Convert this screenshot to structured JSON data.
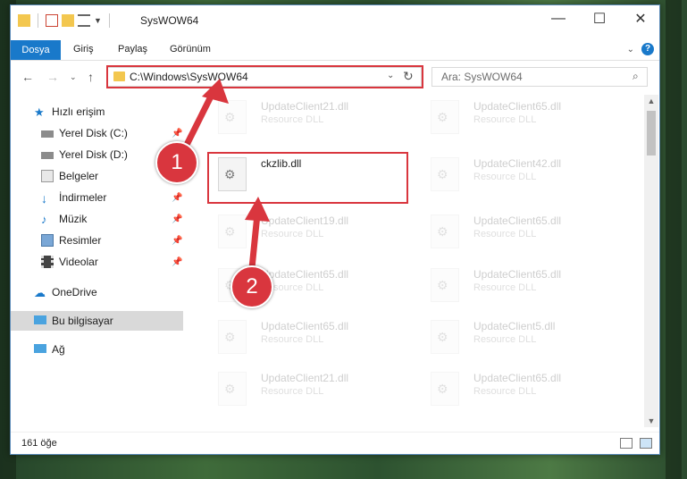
{
  "window": {
    "title": "SysWOW64",
    "controls": [
      "—",
      "☐",
      "✕"
    ]
  },
  "ribbon": {
    "file_tab": "Dosya",
    "tabs": [
      "Giriş",
      "Paylaş",
      "Görünüm"
    ],
    "help": "?"
  },
  "nav": {
    "address": "C:\\Windows\\SysWOW64",
    "search_placeholder": "Ara: SysWOW64"
  },
  "sidebar": {
    "items": [
      {
        "label": "Hızlı erişim",
        "icon": "star-icon",
        "pinned": false
      },
      {
        "label": "Yerel Disk (C:)",
        "icon": "drive-icon",
        "pinned": true
      },
      {
        "label": "Yerel Disk (D:)",
        "icon": "drive-icon",
        "pinned": false
      },
      {
        "label": "Belgeler",
        "icon": "documents-icon",
        "pinned": true
      },
      {
        "label": "İndirmeler",
        "icon": "download-icon",
        "pinned": true
      },
      {
        "label": "Müzik",
        "icon": "music-icon",
        "pinned": true
      },
      {
        "label": "Resimler",
        "icon": "pictures-icon",
        "pinned": true
      },
      {
        "label": "Videolar",
        "icon": "videos-icon",
        "pinned": true
      },
      {
        "label": "OneDrive",
        "icon": "cloud-icon",
        "pinned": false
      },
      {
        "label": "Bu bilgisayar",
        "icon": "computer-icon",
        "pinned": false
      },
      {
        "label": "Ağ",
        "icon": "network-icon",
        "pinned": false
      }
    ]
  },
  "files": {
    "left": [
      {
        "name": "UpdateClient21.dll",
        "type": "Resource DLL"
      },
      {
        "name": "ckzlib.dll",
        "type": ""
      },
      {
        "name": "UpdateClient19.dll",
        "type": "Resource DLL"
      },
      {
        "name": "UpdateClient65.dll",
        "type": "Resource DLL"
      },
      {
        "name": "UpdateClient65.dll",
        "type": "Resource DLL"
      },
      {
        "name": "UpdateClient21.dll",
        "type": "Resource DLL"
      }
    ],
    "right": [
      {
        "name": "UpdateClient65.dll",
        "type": "Resource DLL"
      },
      {
        "name": "UpdateClient42.dll",
        "type": "Resource DLL"
      },
      {
        "name": "UpdateClient65.dll",
        "type": "Resource DLL"
      },
      {
        "name": "UpdateClient65.dll",
        "type": "Resource DLL"
      },
      {
        "name": "UpdateClient5.dll",
        "type": "Resource DLL"
      },
      {
        "name": "UpdateClient65.dll",
        "type": "Resource DLL"
      }
    ]
  },
  "status": {
    "count": "161 öğe"
  },
  "markers": [
    "1",
    "2"
  ],
  "colors": {
    "accent": "#1979ca",
    "highlight": "#d9363e"
  }
}
